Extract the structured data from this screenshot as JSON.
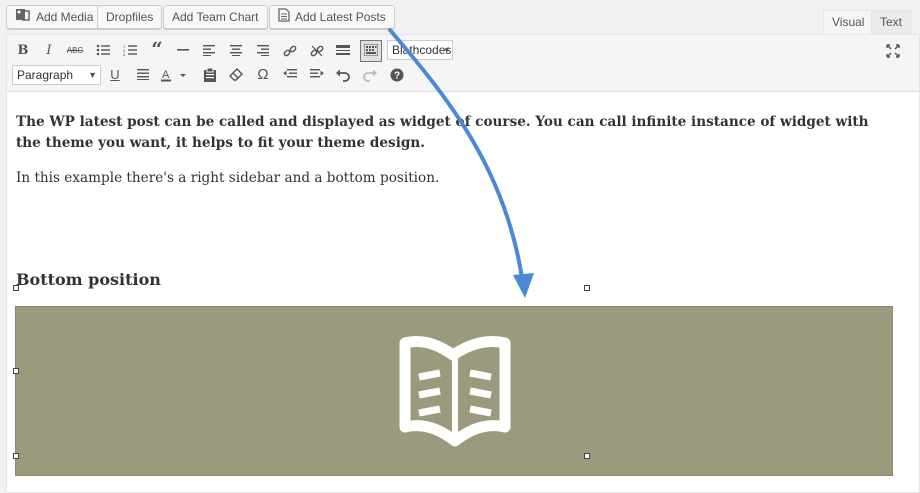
{
  "media_buttons": {
    "add_media": "Add Media",
    "dropfiles": "Dropfiles",
    "add_team_chart": "Add Team Chart",
    "add_latest_posts": "Add Latest Posts"
  },
  "tabs": {
    "visual": "Visual",
    "text": "Text"
  },
  "toolbar": {
    "format_select": "Paragraph",
    "shortcode_select": "Blathcodes"
  },
  "content": {
    "intro_bold": "The WP latest post can be called and displayed as widget of course. You can call infinite instance of widget with the theme you want, it helps to fit your theme design.",
    "intro_normal": "In this example there's a right sidebar and a bottom position.",
    "heading": "Bottom position"
  },
  "colors": {
    "block_background": "#9b9a7c",
    "arrow": "#4a8ad4"
  }
}
